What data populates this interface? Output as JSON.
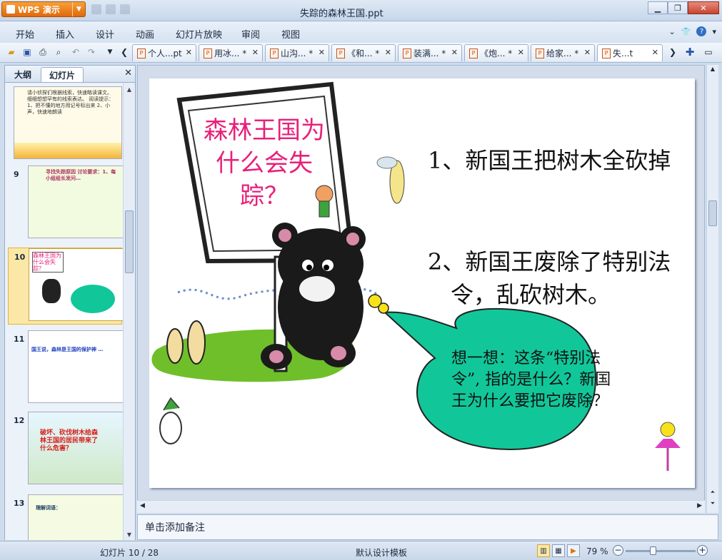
{
  "app": {
    "name": "WPS 演示",
    "window_title": "失踪的森林王国.ppt"
  },
  "menu": [
    "开始",
    "插入",
    "设计",
    "动画",
    "幻灯片放映",
    "审阅",
    "视图"
  ],
  "doc_tabs": [
    {
      "label": "个人...pt",
      "active": false
    },
    {
      "label": "用冰... *",
      "active": false
    },
    {
      "label": "山沟... *",
      "active": false
    },
    {
      "label": "《和... *",
      "active": false
    },
    {
      "label": "装满... *",
      "active": false
    },
    {
      "label": "《炮... *",
      "active": false
    },
    {
      "label": "给家... *",
      "active": false
    },
    {
      "label": "失...t",
      "active": true
    }
  ],
  "panel": {
    "tabs": [
      "大纲",
      "幻灯片"
    ],
    "active_tab": "幻灯片",
    "thumbnails": [
      {
        "num": "8",
        "text": "请小侦探们根据线索，快速略读课文。 细细想想罕有的线索表达。 阅读提示：1、把不懂的地方用记号标出来 2、小声，快速地朗读"
      },
      {
        "num": "9",
        "text": "寻找失踪原因 讨论要求：1、每小组组长发问…"
      },
      {
        "num": "10",
        "text": "森林王国为什么会失踪？"
      },
      {
        "num": "11",
        "text": "国王说，森林是王国的保护神 …"
      },
      {
        "num": "12",
        "text": "破坏、砍伐树木给森林王国的居民带来了什么危害？"
      },
      {
        "num": "13",
        "text": "理解词语："
      }
    ]
  },
  "slide": {
    "sign_title": "森林王国为什么会失踪？",
    "point1": "1、新国王把树木全砍掉",
    "point2": "2、新国王废除了特别法令，乱砍树木。",
    "bubble": "想一想：这条“特别法令”, 指的是什么？新国王为什么要把它废除？"
  },
  "notes_placeholder": "单击添加备注",
  "status": {
    "slide_info": "幻灯片 10 / 28",
    "template": "默认设计模板",
    "zoom": "79 %"
  },
  "colors": {
    "sign_text": "#e8207a",
    "bubble_fill": "#11c79a",
    "grass": "#6fbf2a",
    "wps_orange": "#e9720f"
  }
}
